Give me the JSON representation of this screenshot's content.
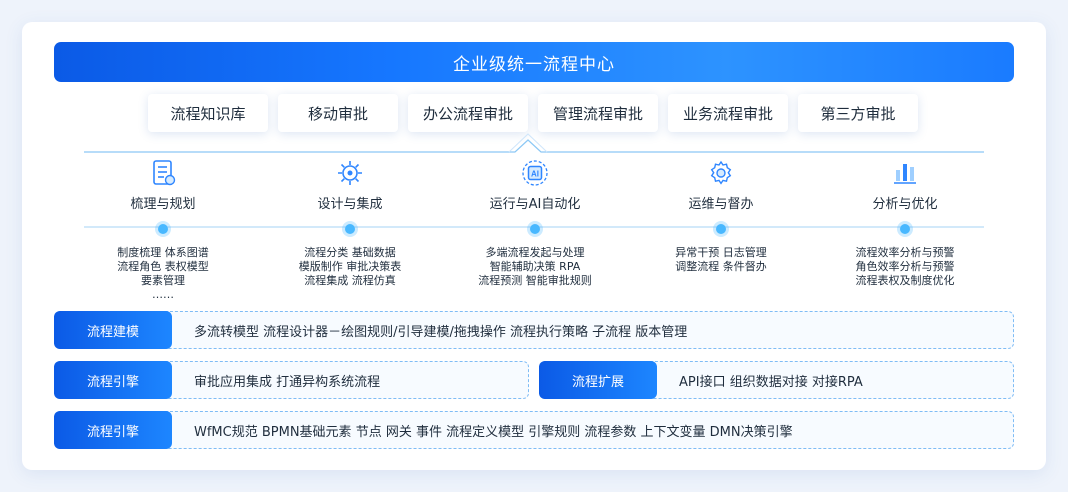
{
  "header": {
    "title": "企业级统一流程中心"
  },
  "tabs": [
    {
      "label": "流程知识库"
    },
    {
      "label": "移动审批"
    },
    {
      "label": "办公流程审批"
    },
    {
      "label": "管理流程审批"
    },
    {
      "label": "业务流程审批"
    },
    {
      "label": "第三方审批"
    }
  ],
  "columns": [
    {
      "icon": "document-list-icon",
      "title": "梳理与规划",
      "items": [
        "制度梳理 体系图谱",
        "流程角色 表权模型",
        "要素管理",
        "……"
      ]
    },
    {
      "icon": "integration-gear-icon",
      "title": "设计与集成",
      "items": [
        "流程分类 基础数据",
        "模版制作 审批决策表",
        "流程集成 流程仿真"
      ]
    },
    {
      "icon": "ai-chip-icon",
      "title": "运行与AI自动化",
      "items": [
        "多端流程发起与处理",
        "智能辅助决策 RPA",
        "流程预测 智能审批规则"
      ]
    },
    {
      "icon": "maintenance-gear-icon",
      "title": "运维与督办",
      "items": [
        "异常干预 日志管理",
        "调整流程 条件督办"
      ]
    },
    {
      "icon": "analytics-icon",
      "title": "分析与优化",
      "items": [
        "流程效率分析与预警",
        "角色效率分析与预警",
        "流程表权及制度优化"
      ]
    }
  ],
  "rows": {
    "modeling": {
      "label": "流程建模",
      "text": "多流转模型   流程设计器－绘图规则/引导建模/拖拽操作   流程执行策略   子流程    版本管理"
    },
    "engine_a": {
      "label": "流程引擎",
      "text": "审批应用集成   打通异构系统流程"
    },
    "extension": {
      "label": "流程扩展",
      "text": "API接口    组织数据对接   对接RPA"
    },
    "engine_b": {
      "label": "流程引擎",
      "text": "WfMC规范 BPMN基础元素  节点 网关  事件   流程定义模型   引擎规则   流程参数    上下文变量   DMN决策引擎"
    }
  },
  "colors": {
    "primary": "#1677ff",
    "dark_blue": "#0b5ae6",
    "accent": "#49b8ff",
    "border": "#7fbcf5"
  }
}
